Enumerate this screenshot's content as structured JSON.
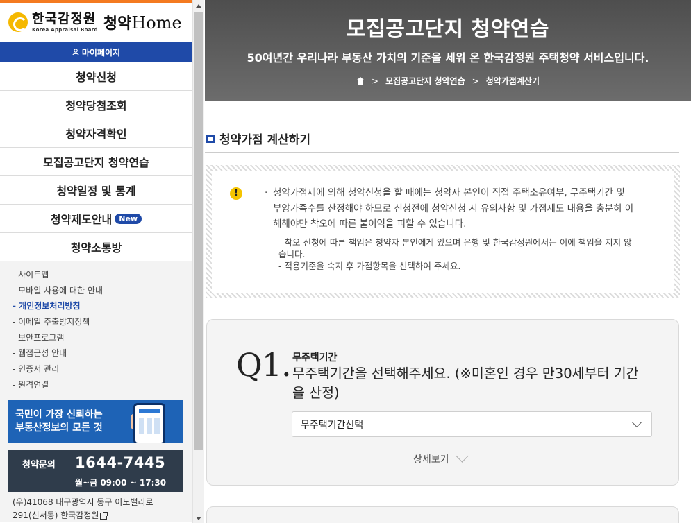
{
  "sidebar": {
    "logo": {
      "ko": "한국감정원",
      "en": "Korea Appraisal Board",
      "brand_ko": "청약",
      "brand_en": "Home"
    },
    "mypage_label": "마이페이지",
    "menu": [
      {
        "label": "청약신청"
      },
      {
        "label": "청약당첨조회"
      },
      {
        "label": "청약자격확인"
      },
      {
        "label": "모집공고단지 청약연습"
      },
      {
        "label": "청약일정 및 통계"
      },
      {
        "label": "청약제도안내",
        "badge": "New"
      },
      {
        "label": "청약소통방"
      }
    ],
    "sub_links": [
      "- 사이트맵",
      "- 모바일 사용에 대한 안내",
      "- 개인정보처리방침",
      "- 이메일 추출방지정책",
      "- 보안프로그램",
      "- 웹접근성 안내",
      "- 인증서 관리",
      "- 원격연결"
    ],
    "active_sub_link_index": 2,
    "banner_app": {
      "line1": "국민이 가장 신뢰하는",
      "line2": "부동산정보의 모든 것"
    },
    "banner_call": {
      "label": "청약문의",
      "number": "1644-7445",
      "hours": "월~금 09:00 ~ 17:30"
    },
    "address": {
      "line1": "(우)41068 대구광역시 동구 이노밸리로",
      "line2": "291(신서동) 한국감정원"
    }
  },
  "hero": {
    "title": "모집공고단지 청약연습",
    "subtitle": "50여년간 우리나라 부동산 가치의 기준을 세워 온 한국감정원 주택청약 서비스입니다.",
    "breadcrumb": [
      "모집공고단지 청약연습",
      "청약가점계산기"
    ]
  },
  "section": {
    "title": "청약가점 계산하기"
  },
  "notice": {
    "bullet": "·",
    "main": "청약가점제에 의해 청약신청을 할 때에는 청약자 본인이 직접 주택소유여부, 무주택기간 및 부양가족수를 산정해야 하므로 신청전에 청약신청 시 유의사항 및 가점제도 내용을 충분히 이해해야만 착오에 따른 불이익을 피할 수 있습니다.",
    "sub1": "- 착오 신청에 따른 책임은 청약자 본인에게 있으며 은행 및 한국감정원에서는 이에 책임을 지지 않습니다.",
    "sub2": "- 적용기준을 숙지 후 가점항목을 선택하여 주세요."
  },
  "question1": {
    "number": "Q1.",
    "label": "무주택기간",
    "text": "무주택기간을 선택해주세요. (※미혼인 경우 만30세부터 기간을 산정)",
    "select_value": "무주택기간선택",
    "detail_label": "상세보기"
  },
  "colors": {
    "accent": "#1f4aa8",
    "orange": "#f47a20",
    "warn": "#f5c400",
    "hero_bg": "#5a5a5a"
  }
}
